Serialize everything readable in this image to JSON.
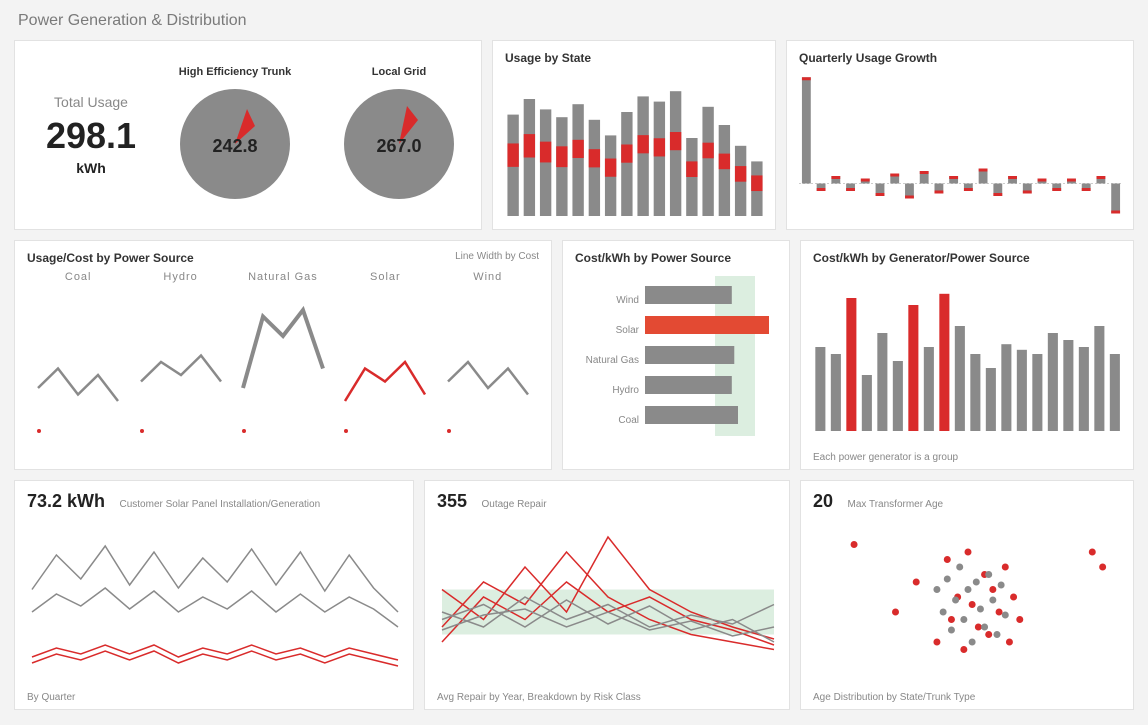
{
  "page_title": "Power Generation & Distribution",
  "row1": {
    "total_usage": {
      "label": "Total Usage",
      "value": "298.1",
      "unit": "kWh"
    },
    "dials": [
      {
        "label": "High Efficiency Trunk",
        "value": "242.8"
      },
      {
        "label": "Local Grid",
        "value": "267.0"
      }
    ],
    "usage_by_state": {
      "title": "Usage by State"
    },
    "quarterly_growth": {
      "title": "Quarterly Usage Growth"
    }
  },
  "row2": {
    "usage_cost": {
      "title": "Usage/Cost by Power Source",
      "subtitle": "Line Width by Cost",
      "sources": [
        "Coal",
        "Hydro",
        "Natural Gas",
        "Solar",
        "Wind"
      ]
    },
    "cost_kwh_source": {
      "title": "Cost/kWh by Power Source",
      "categories": [
        "Wind",
        "Solar",
        "Natural Gas",
        "Hydro",
        "Coal"
      ]
    },
    "cost_kwh_gen": {
      "title": "Cost/kWh by Generator/Power Source",
      "footer": "Each power generator is a group"
    }
  },
  "row3": {
    "solar": {
      "value": "73.2 kWh",
      "title": "Customer Solar Panel Installation/Generation",
      "footer": "By Quarter"
    },
    "outage": {
      "value": "355",
      "title": "Outage Repair",
      "footer": "Avg Repair by Year, Breakdown by Risk Class"
    },
    "transformer": {
      "value": "20",
      "title": "Max Transformer Age",
      "footer": "Age Distribution by State/Trunk Type"
    }
  },
  "chart_data": [
    {
      "type": "bar",
      "id": "usage_by_state",
      "title": "Usage by State",
      "series": [
        {
          "name": "total",
          "values": [
            78,
            90,
            82,
            76,
            86,
            74,
            62,
            80,
            92,
            88,
            96,
            60,
            84,
            70,
            54,
            42
          ]
        },
        {
          "name": "highlight",
          "values": [
            18,
            18,
            16,
            16,
            14,
            14,
            14,
            14,
            14,
            14,
            14,
            12,
            12,
            12,
            12,
            12
          ]
        }
      ],
      "ylim": [
        0,
        100
      ]
    },
    {
      "type": "bar",
      "id": "quarterly_growth",
      "title": "Quarterly Usage Growth",
      "values": [
        85,
        -6,
        6,
        -6,
        4,
        -10,
        8,
        -12,
        10,
        -8,
        6,
        -6,
        12,
        -10,
        6,
        -8,
        4,
        -6,
        4,
        -6,
        6,
        -24
      ],
      "ylim": [
        -30,
        90
      ]
    },
    {
      "type": "line",
      "id": "usage_cost_by_source",
      "title": "Usage/Cost by Power Source",
      "series": [
        {
          "name": "Coal",
          "values": [
            30,
            45,
            25,
            40,
            20
          ]
        },
        {
          "name": "Hydro",
          "values": [
            35,
            50,
            40,
            55,
            35
          ]
        },
        {
          "name": "Natural Gas",
          "values": [
            30,
            85,
            70,
            90,
            45
          ]
        },
        {
          "name": "Solar",
          "values": [
            20,
            45,
            35,
            50,
            25
          ],
          "color": "red"
        },
        {
          "name": "Wind",
          "values": [
            35,
            50,
            30,
            45,
            25
          ]
        }
      ],
      "ylim": [
        0,
        100
      ]
    },
    {
      "type": "bar",
      "id": "cost_kwh_by_source",
      "title": "Cost/kWh by Power Source",
      "orientation": "horizontal",
      "categories": [
        "Wind",
        "Solar",
        "Natural Gas",
        "Hydro",
        "Coal"
      ],
      "values": [
        70,
        100,
        72,
        70,
        75
      ],
      "highlight": "Solar",
      "xlim": [
        0,
        100
      ]
    },
    {
      "type": "bar",
      "id": "cost_kwh_by_generator",
      "title": "Cost/kWh by Generator/Power Source",
      "values": [
        60,
        55,
        95,
        40,
        70,
        50,
        90,
        60,
        98,
        75,
        55,
        45,
        62,
        58,
        55,
        70,
        65,
        60,
        75,
        55
      ],
      "colors": [
        "g",
        "g",
        "r",
        "g",
        "g",
        "g",
        "r",
        "g",
        "r",
        "g",
        "g",
        "g",
        "g",
        "g",
        "g",
        "g",
        "g",
        "g",
        "g",
        "g"
      ],
      "ylim": [
        0,
        100
      ]
    },
    {
      "type": "line",
      "id": "customer_solar",
      "title": "Customer Solar Panel Installation/Generation",
      "series": [
        {
          "name": "s1",
          "values": [
            55,
            78,
            62,
            84,
            58,
            80,
            56,
            76,
            60,
            82,
            58,
            80,
            54,
            78,
            56,
            40
          ]
        },
        {
          "name": "s2",
          "values": [
            40,
            52,
            44,
            56,
            42,
            54,
            40,
            50,
            42,
            54,
            40,
            52,
            40,
            50,
            42,
            30
          ]
        },
        {
          "name": "s3",
          "values": [
            10,
            16,
            12,
            18,
            12,
            18,
            10,
            16,
            12,
            18,
            12,
            16,
            10,
            16,
            12,
            8
          ],
          "color": "red"
        },
        {
          "name": "s4",
          "values": [
            6,
            12,
            8,
            14,
            8,
            14,
            6,
            12,
            8,
            14,
            8,
            12,
            6,
            12,
            8,
            4
          ],
          "color": "red"
        }
      ],
      "ylim": [
        0,
        100
      ]
    },
    {
      "type": "line",
      "id": "outage_repair",
      "title": "Outage Repair",
      "series": [
        {
          "name": "a",
          "values": [
            30,
            60,
            45,
            80,
            50,
            35,
            25,
            20,
            15
          ],
          "color": "red"
        },
        {
          "name": "b",
          "values": [
            55,
            35,
            70,
            40,
            90,
            55,
            40,
            30,
            22
          ],
          "color": "red"
        },
        {
          "name": "c",
          "values": [
            20,
            50,
            35,
            60,
            40,
            50,
            35,
            28,
            18
          ],
          "color": "red"
        },
        {
          "name": "d",
          "values": [
            40,
            30,
            50,
            35,
            45,
            30,
            38,
            32,
            45
          ]
        },
        {
          "name": "e",
          "values": [
            35,
            45,
            30,
            48,
            32,
            44,
            28,
            35,
            20
          ]
        },
        {
          "name": "f",
          "values": [
            28,
            38,
            42,
            30,
            40,
            28,
            34,
            24,
            30
          ]
        }
      ],
      "ylim": [
        0,
        100
      ]
    },
    {
      "type": "scatter",
      "id": "transformer_age",
      "title": "Max Transformer Age",
      "series": [
        {
          "name": "red",
          "points": [
            [
              15,
              85
            ],
            [
              35,
              40
            ],
            [
              45,
              60
            ],
            [
              55,
              20
            ],
            [
              60,
              75
            ],
            [
              62,
              35
            ],
            [
              65,
              50
            ],
            [
              68,
              15
            ],
            [
              70,
              80
            ],
            [
              72,
              45
            ],
            [
              75,
              30
            ],
            [
              78,
              65
            ],
            [
              80,
              25
            ],
            [
              82,
              55
            ],
            [
              85,
              40
            ],
            [
              88,
              70
            ],
            [
              90,
              20
            ],
            [
              92,
              50
            ],
            [
              95,
              35
            ],
            [
              130,
              80
            ],
            [
              135,
              70
            ]
          ]
        },
        {
          "name": "gray",
          "points": [
            [
              55,
              55
            ],
            [
              58,
              40
            ],
            [
              60,
              62
            ],
            [
              62,
              28
            ],
            [
              64,
              48
            ],
            [
              66,
              70
            ],
            [
              68,
              35
            ],
            [
              70,
              55
            ],
            [
              72,
              20
            ],
            [
              74,
              60
            ],
            [
              76,
              42
            ],
            [
              78,
              30
            ],
            [
              80,
              65
            ],
            [
              82,
              48
            ],
            [
              84,
              25
            ],
            [
              86,
              58
            ],
            [
              88,
              38
            ]
          ]
        }
      ],
      "xlim": [
        0,
        140
      ],
      "ylim": [
        0,
        100
      ]
    }
  ]
}
